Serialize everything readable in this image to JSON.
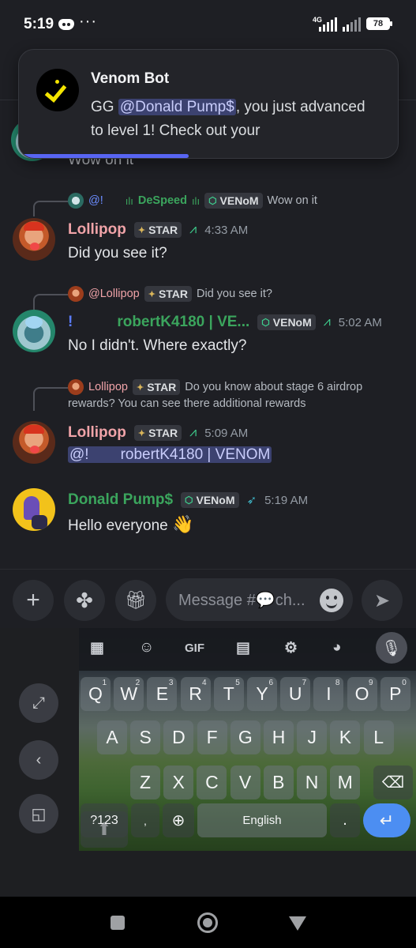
{
  "status_bar": {
    "time": "5:19",
    "dots": "···",
    "network": "4G",
    "battery": "78"
  },
  "toast": {
    "title": "Venom Bot",
    "prefix": "GG ",
    "mention": "@Donald Pump$",
    "suffix": ", you just advanced to level 1! Check out your"
  },
  "partial_message": "Wow on it",
  "messages": [
    {
      "reply": {
        "at": "@!",
        "author": "DeSpeed",
        "tag": "VENoM",
        "text": "Wow on it"
      },
      "author": "Lollipop",
      "tag": "STAR",
      "time": "4:33 AM",
      "text": "Did you see it?"
    },
    {
      "reply": {
        "author": "@Lollipop",
        "tag": "STAR",
        "text": "Did you see it?"
      },
      "prefix": "!",
      "author": "robertK4180 | VE...",
      "tag": "VENoM",
      "time": "5:02 AM",
      "text": "No I didn't. Where exactly?"
    },
    {
      "reply": {
        "author": "Lollipop",
        "tag": "STAR",
        "text": "Do you know about stage 6 airdrop",
        "text2": "rewards? You can see there additional rewards"
      },
      "author": "Lollipop",
      "tag": "STAR",
      "time": "5:09 AM",
      "mention_at": "@!",
      "mention_name": "robertK4180 | VENOM"
    },
    {
      "author": "Donald Pump$",
      "tag": "VENoM",
      "time": "5:19 AM",
      "text": "Hello everyone",
      "emoji": "👋"
    }
  ],
  "composer": {
    "placeholder": "Message #💬ch..."
  },
  "keyboard": {
    "gif": "GIF",
    "row1": [
      "Q",
      "W",
      "E",
      "R",
      "T",
      "Y",
      "U",
      "I",
      "O",
      "P"
    ],
    "row1_hints": [
      "1",
      "2",
      "3",
      "4",
      "5",
      "6",
      "7",
      "8",
      "9",
      "0"
    ],
    "row2": [
      "A",
      "S",
      "D",
      "F",
      "G",
      "H",
      "J",
      "K",
      "L"
    ],
    "row3": [
      "Z",
      "X",
      "C",
      "V",
      "B",
      "N",
      "M"
    ],
    "symbols": "?123",
    "comma": ",",
    "space": "English",
    "period": "."
  },
  "colors": {
    "accent": "#5865f2",
    "green_name": "#3ba55d",
    "lollipop_name": "#f0a3a8",
    "enter_key": "#4c8ef2"
  }
}
